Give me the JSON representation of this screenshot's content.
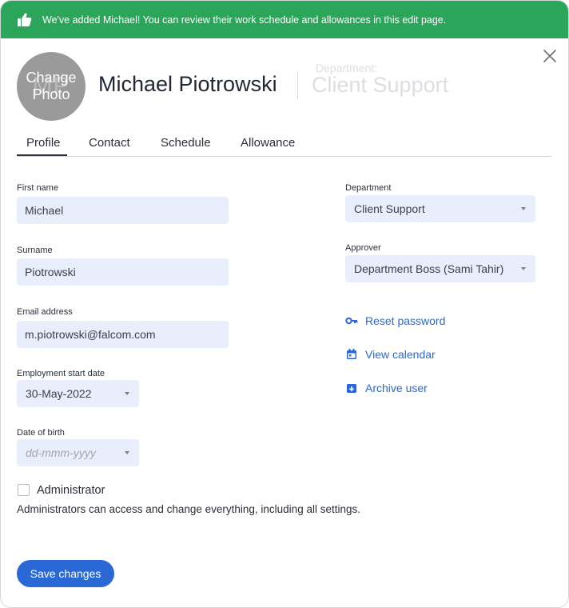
{
  "banner": {
    "message": "We've added Michael! You can review their work schedule and allowances in this edit page."
  },
  "avatar": {
    "initials": "MP",
    "change_line1": "Change",
    "change_line2": "Photo"
  },
  "header": {
    "name": "Michael Piotrowski",
    "department_label": "Department:",
    "department_value": "Client Support"
  },
  "tabs": [
    {
      "label": "Profile",
      "active": true
    },
    {
      "label": "Contact"
    },
    {
      "label": "Schedule"
    },
    {
      "label": "Allowance"
    }
  ],
  "form": {
    "first_name": {
      "label": "First name",
      "value": "Michael"
    },
    "surname": {
      "label": "Surname",
      "value": "Piotrowski"
    },
    "email": {
      "label": "Email address",
      "value": "m.piotrowski@falcom.com"
    },
    "start_date": {
      "label": "Employment start date",
      "value": "30-May-2022"
    },
    "dob": {
      "label": "Date of birth",
      "placeholder": "dd-mmm-yyyy"
    },
    "department": {
      "label": "Department",
      "value": "Client Support"
    },
    "approver": {
      "label": "Approver",
      "value": "Department Boss (Sami Tahir)"
    }
  },
  "actions": {
    "reset_password": "Reset password",
    "view_calendar": "View calendar",
    "archive_user": "Archive user"
  },
  "admin": {
    "label": "Administrator",
    "checked": false,
    "description": "Administrators can access and change everything, including all settings."
  },
  "save_label": "Save changes",
  "colors": {
    "banner": "#2aa559",
    "accent": "#2a68d6",
    "input_bg": "#e8eefb"
  },
  "icons": [
    "thumbs-up-icon",
    "close-icon",
    "key-icon",
    "calendar-icon",
    "archive-icon",
    "caret-down-icon"
  ]
}
